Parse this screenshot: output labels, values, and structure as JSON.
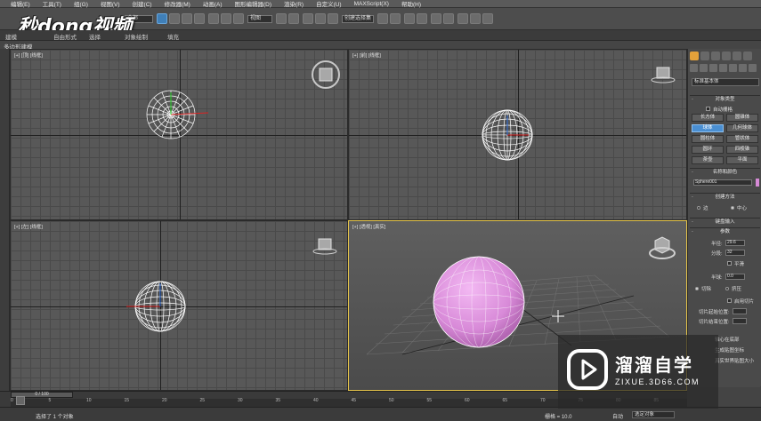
{
  "app": {
    "menus": [
      "编辑(E)",
      "工具(T)",
      "组(G)",
      "视图(V)",
      "创建(C)",
      "修改器(M)",
      "动画(A)",
      "图形编辑器(D)",
      "渲染(R)",
      "自定义(U)",
      "MAXScript(X)",
      "帮助(H)"
    ]
  },
  "toolbar": {
    "selection_filter": "全部",
    "ref_coord": "视图",
    "named_selection": "创建选择集"
  },
  "ribbon": {
    "tabs": [
      "建模",
      "自由形式",
      "选择",
      "对象绘制",
      "填充"
    ],
    "subtab": "多边形建模"
  },
  "logo_tl": "秒dong视频",
  "viewports": {
    "top_left": {
      "label": "[+] [顶] [线框]"
    },
    "top_right": {
      "label": "[+] [前] [线框]"
    },
    "bottom_left": {
      "label": "[+] [左] [线框]"
    },
    "bottom_right": {
      "label": "[+] [透视] [真实]"
    }
  },
  "command_panel": {
    "category": "标准基本体",
    "object_type": {
      "title": "对象类型",
      "autogrid": "自动栅格",
      "buttons": [
        "长方体",
        "圆锥体",
        "球体",
        "几何球体",
        "圆柱体",
        "管状体",
        "圆环",
        "四棱锥",
        "茶壶",
        "平面"
      ],
      "selected": "球体"
    },
    "name_color": {
      "title": "名称和颜色",
      "name": "Sphere001",
      "color": "#d68ad6"
    },
    "creation_method": {
      "title": "创建方法",
      "edge": "边",
      "center": "中心"
    },
    "keyboard_entry": {
      "title": "键盘输入"
    },
    "parameters": {
      "title": "参数",
      "radius_label": "半径:",
      "radius": "29.6",
      "segments_label": "分段:",
      "segments": "32",
      "smooth": "平滑",
      "hemisphere_label": "半球:",
      "hemisphere": "0.0",
      "chop": "切除",
      "squash": "挤压",
      "slice_on": "启用切片",
      "slice_from": "切片起始位置:",
      "slice_to": "切片结束位置:",
      "base_pivot": "轴心在底部",
      "gen_map": "生成贴图坐标",
      "real_world": "真实世界贴图大小"
    }
  },
  "timeline": {
    "frame": "0 / 100",
    "ticks": [
      "0",
      "5",
      "10",
      "15",
      "20",
      "25",
      "30",
      "35",
      "40",
      "45",
      "50",
      "55",
      "60",
      "65",
      "70",
      "75",
      "80",
      "85"
    ]
  },
  "status": {
    "selected": "选择了 1 个对象",
    "grid": "栅格 = 10.0",
    "auto": "自动",
    "sel_obj": "选定对象"
  },
  "watermark": {
    "title": "溜溜自学",
    "url": "ZIXUE.3D66.COM"
  }
}
